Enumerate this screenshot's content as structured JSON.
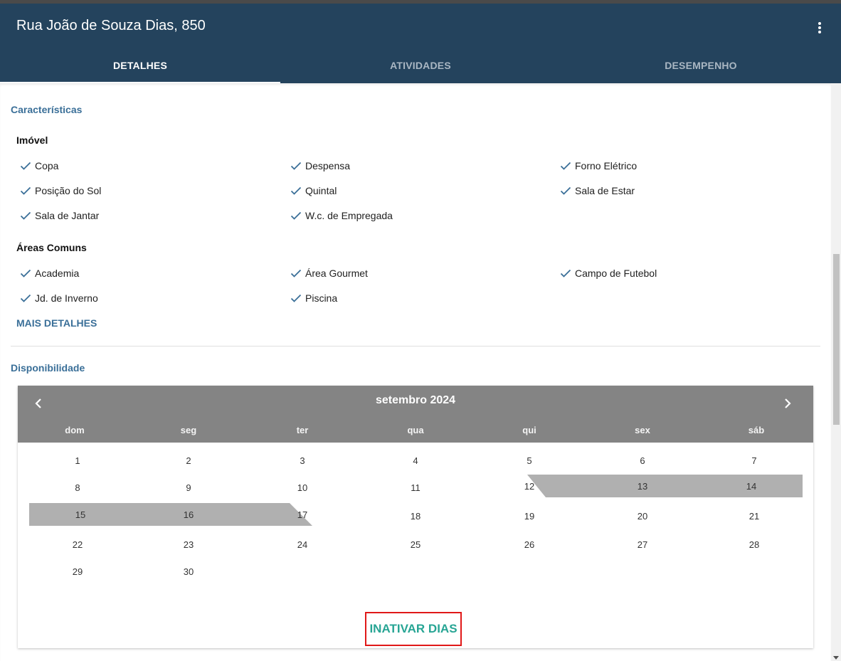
{
  "header": {
    "title": "Rua João de Souza Dias, 850",
    "menu_icon": "more-vertical-icon"
  },
  "tabs": [
    {
      "label": "DETALHES",
      "active": true
    },
    {
      "label": "ATIVIDADES",
      "active": false
    },
    {
      "label": "DESEMPENHO",
      "active": false
    }
  ],
  "caracteristicas": {
    "title": "Características",
    "imovel": {
      "title": "Imóvel",
      "items": [
        "Copa",
        "Despensa",
        "Forno Elétrico",
        "Posição do Sol",
        "Quintal",
        "Sala de Estar",
        "Sala de Jantar",
        "W.c. de Empregada"
      ]
    },
    "areas_comuns": {
      "title": "Áreas Comuns",
      "items": [
        "Academia",
        "Área Gourmet",
        "Campo de Futebol",
        "Jd. de Inverno",
        "Piscina"
      ]
    },
    "more_label": "MAIS DETALHES"
  },
  "disponibilidade": {
    "title": "Disponibilidade",
    "calendar": {
      "month_label": "setembro 2024",
      "weekdays": [
        "dom",
        "seg",
        "ter",
        "qua",
        "qui",
        "sex",
        "sáb"
      ],
      "days": [
        "1",
        "2",
        "3",
        "4",
        "5",
        "6",
        "7",
        "8",
        "9",
        "10",
        "11",
        "12",
        "13",
        "14",
        "15",
        "16",
        "17",
        "18",
        "19",
        "20",
        "21",
        "22",
        "23",
        "24",
        "25",
        "26",
        "27",
        "28",
        "29",
        "30"
      ],
      "inactive_range": {
        "start": "12",
        "end": "17"
      },
      "header_color": "#848484",
      "inactive_color": "#b0b0b0"
    },
    "action_label": "INATIVAR DIAS"
  },
  "colors": {
    "header_bg": "#24435d",
    "section_title": "#3a6f98",
    "action": "#27a594",
    "highlight_border": "#e01818"
  }
}
